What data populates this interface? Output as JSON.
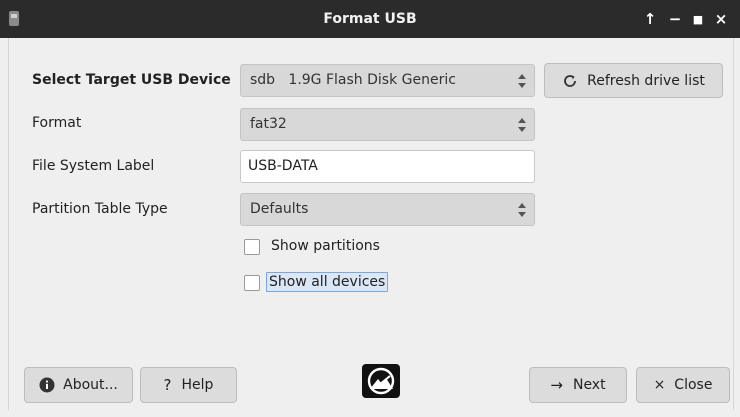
{
  "window": {
    "title": "Format USB",
    "controls": [
      "↑",
      "−",
      "■",
      "×"
    ]
  },
  "form": {
    "target_label": "Select Target USB Device",
    "device_value": "sdb   1.9G Flash Disk Generic",
    "refresh_label": "Refresh drive list",
    "format_label": "Format",
    "format_value": "fat32",
    "fs_label_label": "File System Label",
    "fs_label_value": "USB-DATA",
    "partition_label": "Partition Table Type",
    "partition_value": "Defaults",
    "show_partitions_label": "Show partitions",
    "show_partitions_checked": false,
    "show_all_devices_label": "Show all devices",
    "show_all_devices_checked": false
  },
  "footer": {
    "about_label": "About...",
    "help_label": "Help",
    "next_label": "Next",
    "close_label": "Close"
  }
}
